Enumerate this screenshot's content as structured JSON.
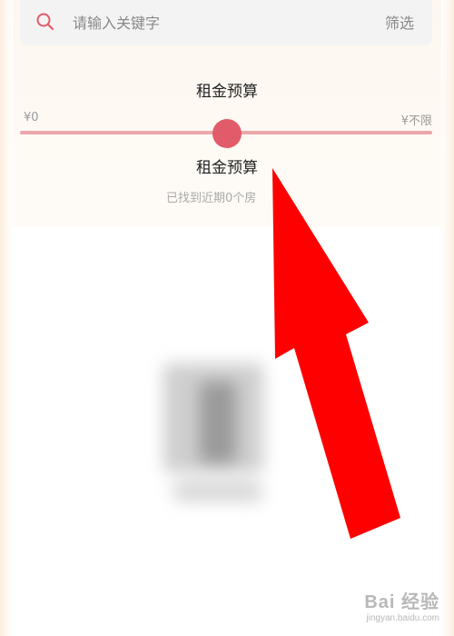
{
  "search": {
    "placeholder": "请输入关键字",
    "filter_label": "筛选"
  },
  "budget": {
    "title": "租金预算",
    "min_label": "¥0",
    "max_label": "¥不限",
    "slider_value_fraction": 0.5,
    "label": "租金预算"
  },
  "results": {
    "found_text": "已找到近期0个房"
  },
  "watermark": {
    "brand": "Bai 经验",
    "url": "jingyan.baidu.com"
  },
  "icons": {
    "search": "search-icon",
    "arrow": "red-arrow-icon"
  },
  "colors": {
    "accent": "#e25b6a",
    "track": "#eaa7aa",
    "arrow": "#ff0000"
  }
}
